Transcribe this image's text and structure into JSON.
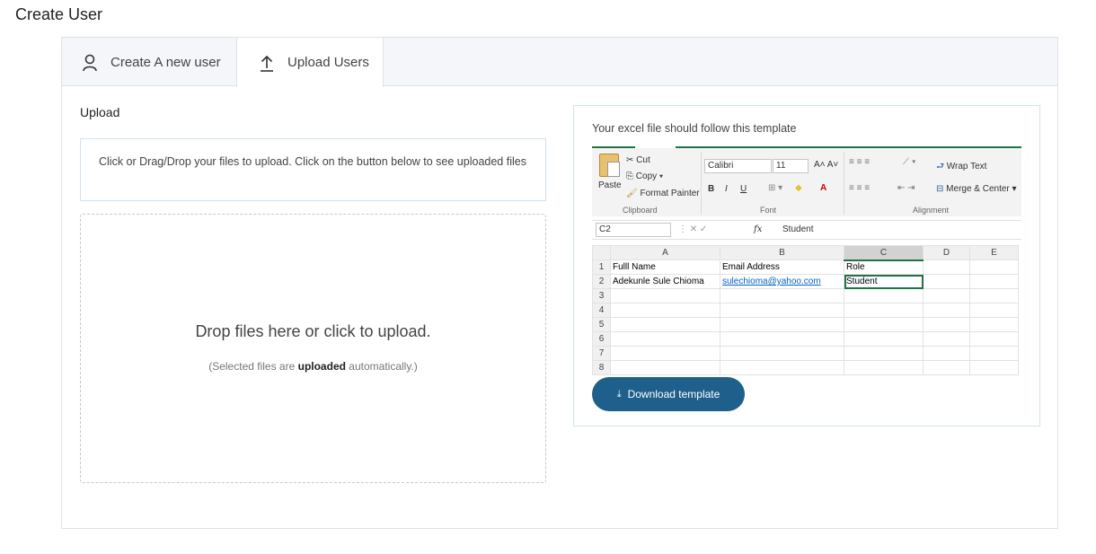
{
  "page": {
    "title": "Create User"
  },
  "tabs": [
    {
      "label": "Create A new user",
      "icon": "user-icon",
      "active": false
    },
    {
      "label": "Upload Users",
      "icon": "upload-icon",
      "active": true
    }
  ],
  "upload": {
    "section_label": "Upload",
    "instructions": "Click or Drag/Drop your files to upload. Click on the button below to see uploaded files",
    "dropzone_message": "Drop files here or click to upload.",
    "dropzone_note_prefix": "(Selected files are ",
    "dropzone_note_bold": "uploaded",
    "dropzone_note_suffix": " automatically.)"
  },
  "template": {
    "caption": "Your excel file should follow this template",
    "download_label": "Download template",
    "excel": {
      "ribbon": {
        "cut": "Cut",
        "copy": "Copy",
        "format_painter": "Format Painter",
        "paste": "Paste",
        "clipboard_group": "Clipboard",
        "font_name": "Calibri",
        "font_size": "11",
        "font_group": "Font",
        "wrap_text": "Wrap Text",
        "merge_center": "Merge & Center",
        "alignment_group": "Alignment",
        "bold": "B",
        "italic": "I",
        "underline": "U"
      },
      "name_box": "C2",
      "fx": "fx",
      "formula_value": "Student",
      "columns": [
        "A",
        "B",
        "C",
        "D",
        "E"
      ],
      "rows": [
        {
          "n": "1",
          "a": "Fulll Name",
          "b": "Email Address",
          "c": "Role"
        },
        {
          "n": "2",
          "a": "Adekunle Sule Chioma",
          "b": "sulechioma@yahoo.com",
          "c": "Student"
        },
        {
          "n": "3",
          "a": "",
          "b": "",
          "c": ""
        },
        {
          "n": "4",
          "a": "",
          "b": "",
          "c": ""
        },
        {
          "n": "5",
          "a": "",
          "b": "",
          "c": ""
        },
        {
          "n": "6",
          "a": "",
          "b": "",
          "c": ""
        },
        {
          "n": "7",
          "a": "",
          "b": "",
          "c": ""
        },
        {
          "n": "8",
          "a": "",
          "b": "",
          "c": ""
        }
      ]
    }
  },
  "colors": {
    "button": "#1f5f8b",
    "excel_green": "#217346",
    "link": "#0563c1"
  }
}
